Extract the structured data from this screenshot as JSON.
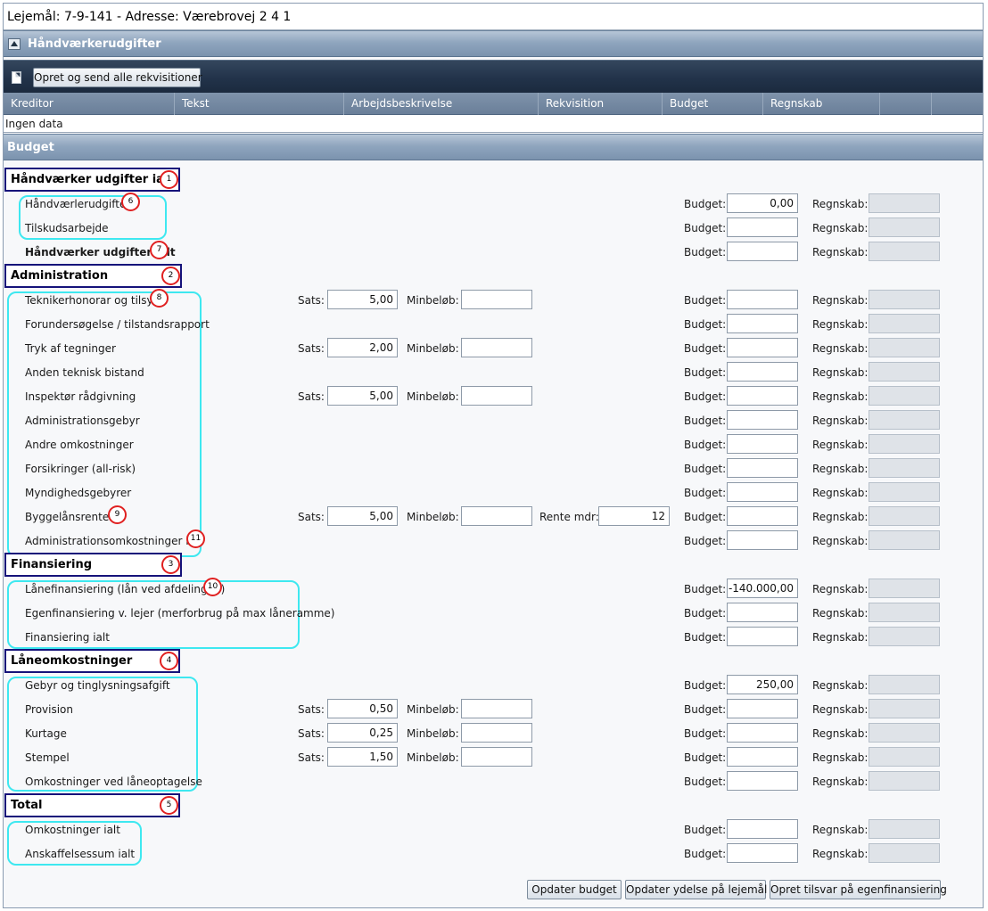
{
  "window_title": "Lejemål: 7-9-141 - Adresse: Værebrovej 2 4 1",
  "hv_section": {
    "header": "Håndværkerudgifter",
    "toolbar_button": "Opret og send alle rekvisitioner",
    "columns": [
      "Kreditor",
      "Tekst",
      "Arbejdsbeskrivelse",
      "Rekvisition",
      "Budget",
      "Regnskab",
      "",
      ""
    ],
    "empty_text": "Ingen data"
  },
  "budget_section": {
    "header": "Budget"
  },
  "labels": {
    "budget": "Budget:",
    "regnskab": "Regnskab:",
    "sats": "Sats:",
    "minbelob": "Minbeløb:",
    "rente_mdr": "Rente mdr:"
  },
  "groups": {
    "g1": {
      "title": "Håndværker udgifter ialt",
      "marker": "1",
      "rows": [
        {
          "label": "Håndværlerudgifter",
          "marker": "6",
          "budget": "0,00",
          "regnskab": ""
        },
        {
          "label": "Tilskudsarbejde",
          "budget": "",
          "regnskab": ""
        },
        {
          "label": "Håndværker udgifter ialt",
          "marker": "7",
          "budget": "",
          "regnskab": ""
        }
      ]
    },
    "g2": {
      "title": "Administration",
      "marker": "2",
      "rows": [
        {
          "label": "Teknikerhonorar og tilsyn",
          "marker": "8",
          "sats": "5,00",
          "minbelob": "",
          "budget": "",
          "regnskab": ""
        },
        {
          "label": "Forundersøgelse / tilstandsrapport",
          "budget": "",
          "regnskab": ""
        },
        {
          "label": "Tryk af tegninger",
          "sats": "2,00",
          "minbelob": "",
          "budget": "",
          "regnskab": ""
        },
        {
          "label": "Anden teknisk bistand",
          "budget": "",
          "regnskab": ""
        },
        {
          "label": "Inspektør rådgivning",
          "sats": "5,00",
          "minbelob": "",
          "budget": "",
          "regnskab": ""
        },
        {
          "label": "Administrationsgebyr",
          "budget": "",
          "regnskab": ""
        },
        {
          "label": "Andre omkostninger",
          "budget": "",
          "regnskab": ""
        },
        {
          "label": "Forsikringer (all-risk)",
          "budget": "",
          "regnskab": ""
        },
        {
          "label": "Myndighedsgebyrer",
          "budget": "",
          "regnskab": ""
        },
        {
          "label": "Byggelånsrenter",
          "marker": "9",
          "sats": "5,00",
          "minbelob": "",
          "rente_mdr": "12",
          "budget": "",
          "regnskab": ""
        },
        {
          "label": "Administrationsomkostninger ialt",
          "marker": "11",
          "budget": "",
          "regnskab": ""
        }
      ]
    },
    "g3": {
      "title": "Finansiering",
      "marker": "3",
      "rows": [
        {
          "label": "Lånefinansiering (lån ved afdelingen)",
          "marker": "10",
          "budget": "-140.000,00",
          "regnskab": ""
        },
        {
          "label": "Egenfinansiering v. lejer (merforbrug på max låneramme)",
          "budget": "",
          "regnskab": ""
        },
        {
          "label": "Finansiering ialt",
          "budget": "",
          "regnskab": ""
        }
      ]
    },
    "g4": {
      "title": "Låneomkostninger",
      "marker": "4",
      "rows": [
        {
          "label": "Gebyr og tinglysningsafgift",
          "budget": "250,00",
          "regnskab": ""
        },
        {
          "label": "Provision",
          "sats": "0,50",
          "minbelob": "",
          "budget": "",
          "regnskab": ""
        },
        {
          "label": "Kurtage",
          "sats": "0,25",
          "minbelob": "",
          "budget": "",
          "regnskab": ""
        },
        {
          "label": "Stempel",
          "sats": "1,50",
          "minbelob": "",
          "budget": "",
          "regnskab": ""
        },
        {
          "label": "Omkostninger ved låneoptagelse",
          "budget": "",
          "regnskab": ""
        }
      ]
    },
    "g5": {
      "title": "Total",
      "marker": "5",
      "rows": [
        {
          "label": "Omkostninger ialt",
          "budget": "",
          "regnskab": ""
        },
        {
          "label": "Anskaffelsessum ialt",
          "budget": "",
          "regnskab": ""
        }
      ]
    }
  },
  "footer_buttons": {
    "update_budget": "Opdater budget",
    "update_yield": "Opdater ydelse på lejemål",
    "create_offset": "Opret tilsvar på egenfinansiering"
  },
  "colors": {
    "header_blue": "#7b93ae",
    "toolbar_dark": "#22334a",
    "group_border": "#15127a",
    "cyan_annotation": "#3ee8f0",
    "red_marker": "#e02020",
    "readonly_field": "#dfe3e8"
  }
}
